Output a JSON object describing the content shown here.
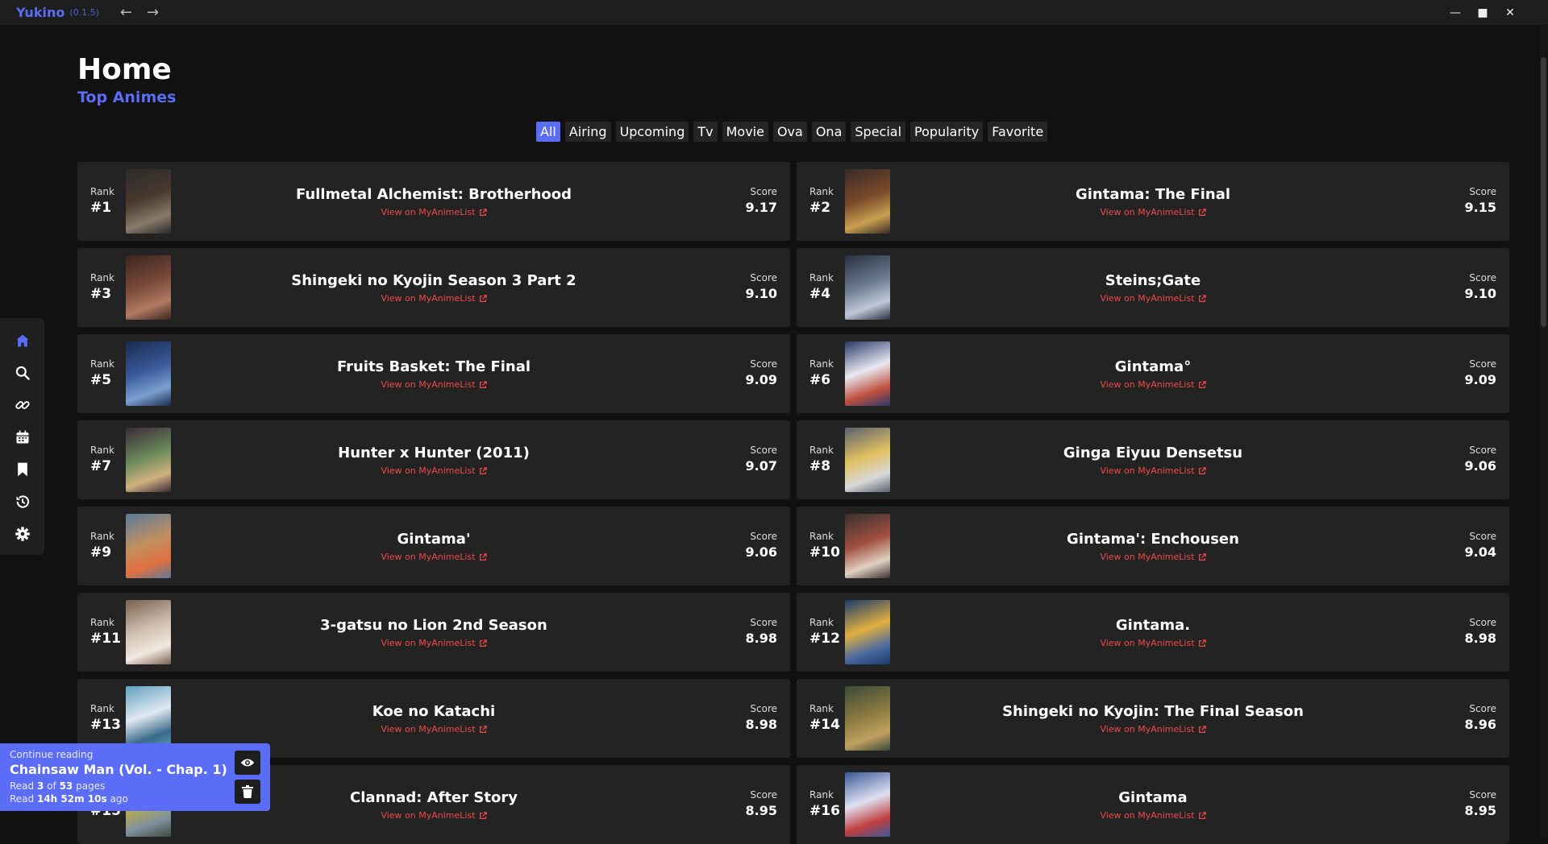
{
  "app": {
    "name": "Yukino",
    "version": "(0.1.5)"
  },
  "window": {
    "minimize_icon": "minimize-icon",
    "maximize_icon": "maximize-icon",
    "close_icon": "close-icon"
  },
  "header": {
    "title": "Home",
    "subtitle": "Top Animes"
  },
  "filters": [
    "All",
    "Airing",
    "Upcoming",
    "Tv",
    "Movie",
    "Ova",
    "Ona",
    "Special",
    "Popularity",
    "Favorite"
  ],
  "active_filter": "All",
  "sidebar": [
    "home-icon",
    "search-icon",
    "link-icon",
    "calendar-icon",
    "bookmark-icon",
    "history-icon",
    "settings-icon"
  ],
  "colors": {
    "accent": "#5b6cf7",
    "link": "#f04a4a",
    "card": "#232323",
    "background": "#111111"
  },
  "card_labels": {
    "rank": "Rank",
    "score": "Score",
    "link": "View on MyAnimeList"
  },
  "animes": [
    {
      "rank": "#1",
      "title": "Fullmetal Alchemist: Brotherhood",
      "score": "9.17"
    },
    {
      "rank": "#2",
      "title": "Gintama: The Final",
      "score": "9.15"
    },
    {
      "rank": "#3",
      "title": "Shingeki no Kyojin Season 3 Part 2",
      "score": "9.10"
    },
    {
      "rank": "#4",
      "title": "Steins;Gate",
      "score": "9.10"
    },
    {
      "rank": "#5",
      "title": "Fruits Basket: The Final",
      "score": "9.09"
    },
    {
      "rank": "#6",
      "title": "Gintama°",
      "score": "9.09"
    },
    {
      "rank": "#7",
      "title": "Hunter x Hunter (2011)",
      "score": "9.07"
    },
    {
      "rank": "#8",
      "title": "Ginga Eiyuu Densetsu",
      "score": "9.06"
    },
    {
      "rank": "#9",
      "title": "Gintama'",
      "score": "9.06"
    },
    {
      "rank": "#10",
      "title": "Gintama': Enchousen",
      "score": "9.04"
    },
    {
      "rank": "#11",
      "title": "3-gatsu no Lion 2nd Season",
      "score": "8.98"
    },
    {
      "rank": "#12",
      "title": "Gintama.",
      "score": "8.98"
    },
    {
      "rank": "#13",
      "title": "Koe no Katachi",
      "score": "8.98"
    },
    {
      "rank": "#14",
      "title": "Shingeki no Kyojin: The Final Season",
      "score": "8.96"
    },
    {
      "rank": "#15",
      "title": "Clannad: After Story",
      "score": "8.95"
    },
    {
      "rank": "#16",
      "title": "Gintama",
      "score": "8.95"
    }
  ],
  "continue_reading": {
    "label": "Continue reading",
    "title": "Chainsaw Man (Vol. - Chap. 1)",
    "pages_prefix": "Read",
    "pages_current": "3",
    "pages_of": "of",
    "pages_total": "53",
    "pages_suffix": "pages",
    "ago_prefix": "Read",
    "ago_value": "14h 52m 10s",
    "ago_suffix": "ago"
  }
}
